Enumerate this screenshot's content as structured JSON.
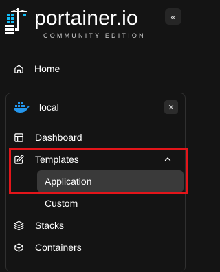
{
  "brand": {
    "name": "portainer.io",
    "edition": "COMMUNITY EDITION"
  },
  "header": {
    "collapse_glyph": "«"
  },
  "nav": {
    "home": "Home"
  },
  "environment": {
    "name": "local",
    "close_glyph": "✕",
    "items": {
      "dashboard": "Dashboard",
      "templates": "Templates",
      "application": "Application",
      "custom": "Custom",
      "stacks": "Stacks",
      "containers": "Containers"
    }
  },
  "colors": {
    "background": "#141414",
    "highlight": "#3a3a3a",
    "annotation_box": "#e3151a",
    "brand_blue": "#13bef9"
  }
}
